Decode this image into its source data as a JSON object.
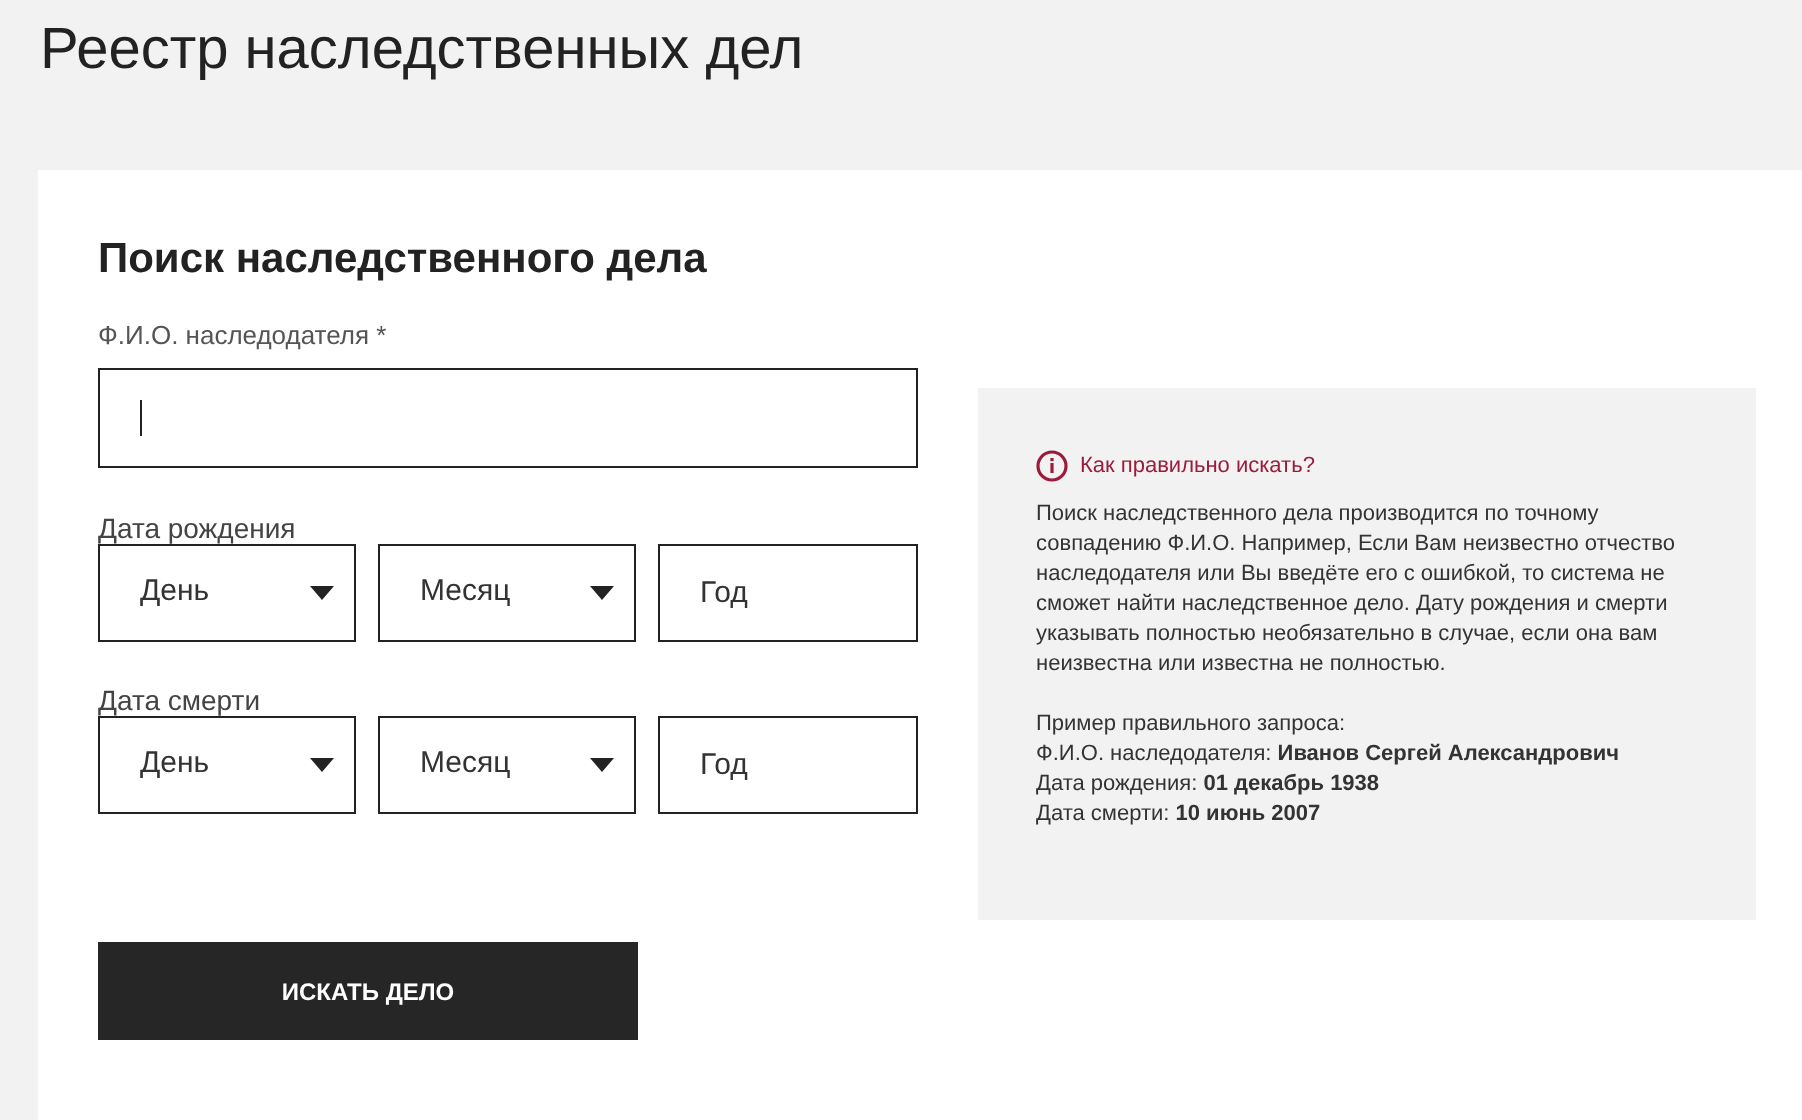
{
  "page_title": "Реестр наследственных дел",
  "form": {
    "title": "Поиск наследственного дела",
    "name_field": {
      "label": "Ф.И.О. наследодателя *",
      "focused": true
    },
    "date_groups": [
      {
        "label": "Дата рождения",
        "day": {
          "placeholder": "День"
        },
        "month": {
          "placeholder": "Месяц"
        },
        "year": {
          "placeholder": "Год"
        }
      },
      {
        "label": "Дата смерти",
        "day": {
          "placeholder": "День"
        },
        "month": {
          "placeholder": "Месяц"
        },
        "year": {
          "placeholder": "Год"
        }
      }
    ],
    "submit_button": "ИСКАТЬ ДЕЛО"
  },
  "help": {
    "title": "Как правильно искать?",
    "text": "Поиск наследственного дела производится по точному совпадению Ф.И.О. Например, Если Вам неизвестно отчество наследодателя или Вы введёте его с ошибкой, то система не сможет найти наследственное дело. Дату рождения и смерти указывать полностью необязательно в случае, если она вам неизвестна или известна не полностью.",
    "example_lines": [
      "Пример правильного запроса:",
      "Ф.И.О. наследодателя: **Иванов Сергей Александрович**",
      "Дата рождения: **01 декабрь 1938**",
      "Дата смерти: **10 июнь 2007**"
    ]
  }
}
